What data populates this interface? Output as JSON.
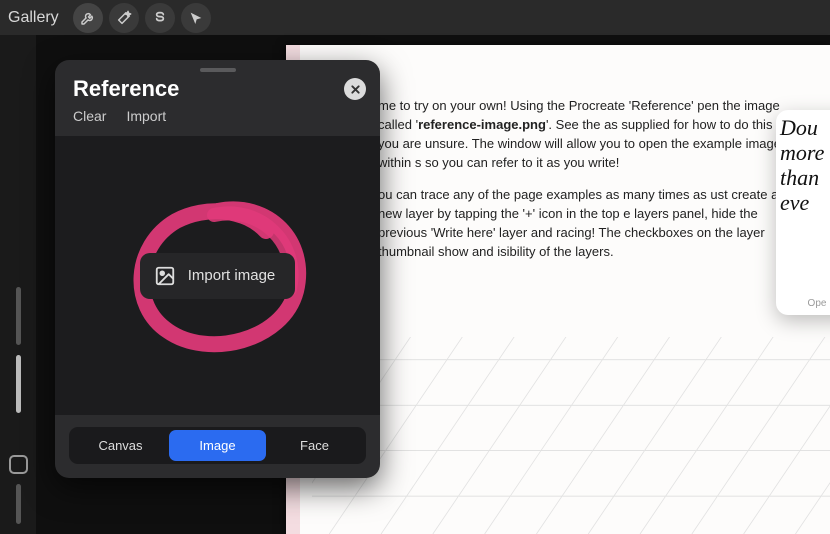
{
  "toolbar": {
    "gallery_label": "Gallery",
    "icons": [
      "wrench-icon",
      "wand-icon",
      "s-icon",
      "pointer-icon"
    ]
  },
  "reference_panel": {
    "title": "Reference",
    "action_clear": "Clear",
    "action_import": "Import",
    "import_button_label": "Import image",
    "segments": {
      "canvas": "Canvas",
      "image": "Image",
      "face": "Face"
    },
    "active_segment": "image"
  },
  "document": {
    "paragraph1_part1": "me to try on your own! Using the Procreate 'Reference' pen the image called '",
    "paragraph1_bold": "reference-image.png",
    "paragraph1_part2": "'. See the as supplied for how to do this if you are unsure. The window will allow you to open the example image within s so you can refer to it as you write!",
    "paragraph2": "ou can trace any of the page examples as many times as ust create a new layer by tapping the '+' icon in the top e layers panel, hide the previous 'Write here' layer and racing! The checkboxes on the layer thumbnail show and isibility of the layers."
  },
  "preview_card": {
    "lines": [
      "Dou",
      "more",
      "than",
      "eve"
    ],
    "footer": "Ope"
  }
}
